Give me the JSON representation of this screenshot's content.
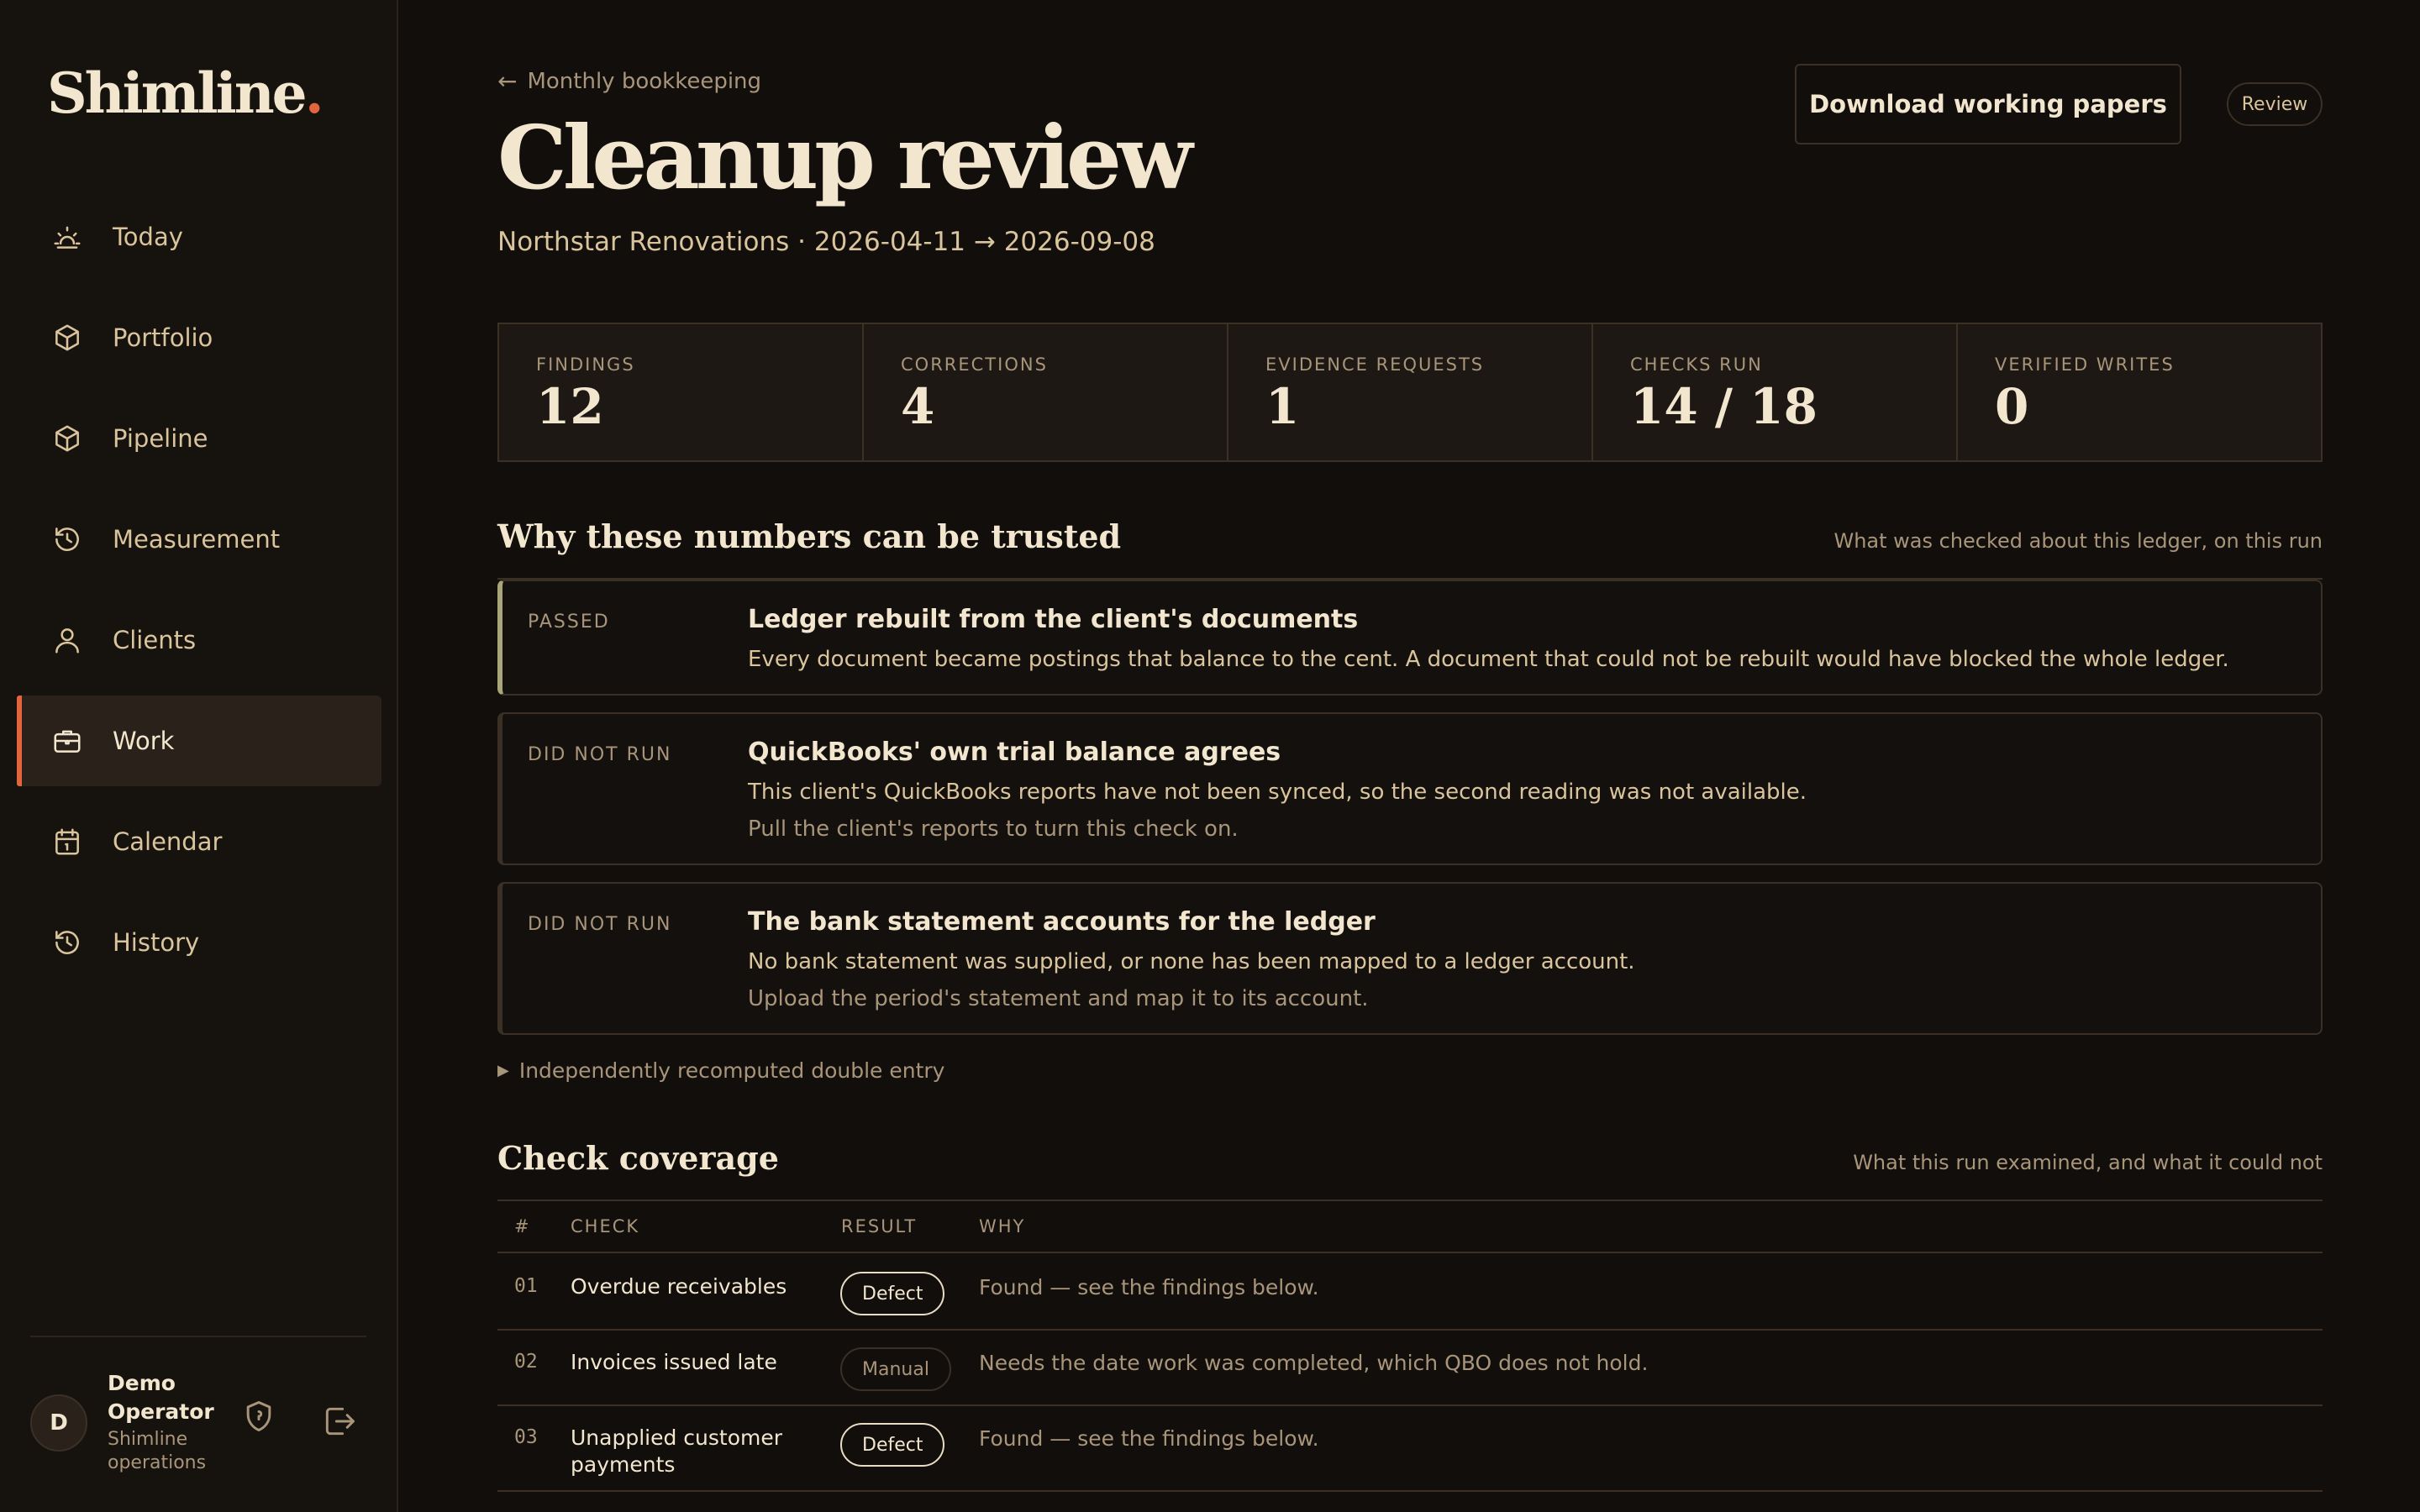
{
  "app": {
    "logo_text": "Shimline",
    "logo_dot": "."
  },
  "sidebar": {
    "items": [
      {
        "label": "Today",
        "icon": "sun-icon"
      },
      {
        "label": "Portfolio",
        "icon": "box-icon"
      },
      {
        "label": "Pipeline",
        "icon": "box-icon"
      },
      {
        "label": "Measurement",
        "icon": "history-icon"
      },
      {
        "label": "Clients",
        "icon": "user-icon"
      },
      {
        "label": "Work",
        "icon": "briefcase-icon",
        "active": true
      },
      {
        "label": "Calendar",
        "icon": "calendar-icon"
      },
      {
        "label": "History",
        "icon": "history-icon"
      }
    ],
    "user": {
      "initial": "D",
      "name": "Demo Operator",
      "org": "Shimline operations"
    }
  },
  "header": {
    "breadcrumb": "Monthly bookkeeping",
    "title": "Cleanup review",
    "subtitle": "Northstar Renovations · 2026-04-11 → 2026-09-08",
    "download_label": "Download working papers",
    "status_pill": "Review"
  },
  "stats": [
    {
      "label": "Findings",
      "value": "12"
    },
    {
      "label": "Corrections",
      "value": "4"
    },
    {
      "label": "Evidence requests",
      "value": "1"
    },
    {
      "label": "Checks run",
      "value": "14 / 18"
    },
    {
      "label": "Verified writes",
      "value": "0"
    }
  ],
  "trust": {
    "title": "Why these numbers can be trusted",
    "note": "What was checked about this ledger, on this run",
    "cards": [
      {
        "status": "PASSED",
        "title": "Ledger rebuilt from the client's documents",
        "text": "Every document became postings that balance to the cent. A document that could not be rebuilt would have blocked the whole ledger.",
        "hint": ""
      },
      {
        "status": "DID NOT RUN",
        "title": "QuickBooks' own trial balance agrees",
        "text": "This client's QuickBooks reports have not been synced, so the second reading was not available.",
        "hint": "Pull the client's reports to turn this check on."
      },
      {
        "status": "DID NOT RUN",
        "title": "The bank statement accounts for the ledger",
        "text": "No bank statement was supplied, or none has been mapped to a ledger account.",
        "hint": "Upload the period's statement and map it to its account."
      }
    ],
    "details_label": "Independently recomputed double entry"
  },
  "coverage": {
    "title": "Check coverage",
    "note": "What this run examined, and what it could not",
    "columns": {
      "num": "#",
      "check": "CHECK",
      "result": "RESULT",
      "why": "WHY"
    },
    "rows": [
      {
        "num": "01",
        "check": "Overdue receivables",
        "result": "Defect",
        "why": "Found — see the findings below."
      },
      {
        "num": "02",
        "check": "Invoices issued late",
        "result": "Manual",
        "why": "Needs the date work was completed, which QBO does not hold."
      },
      {
        "num": "03",
        "check": "Unapplied customer payments",
        "result": "Defect",
        "why": "Found — see the findings below."
      }
    ]
  },
  "colors": {
    "accent": "#e3643d",
    "background": "#110e0b",
    "passed": "#a8a57a"
  }
}
